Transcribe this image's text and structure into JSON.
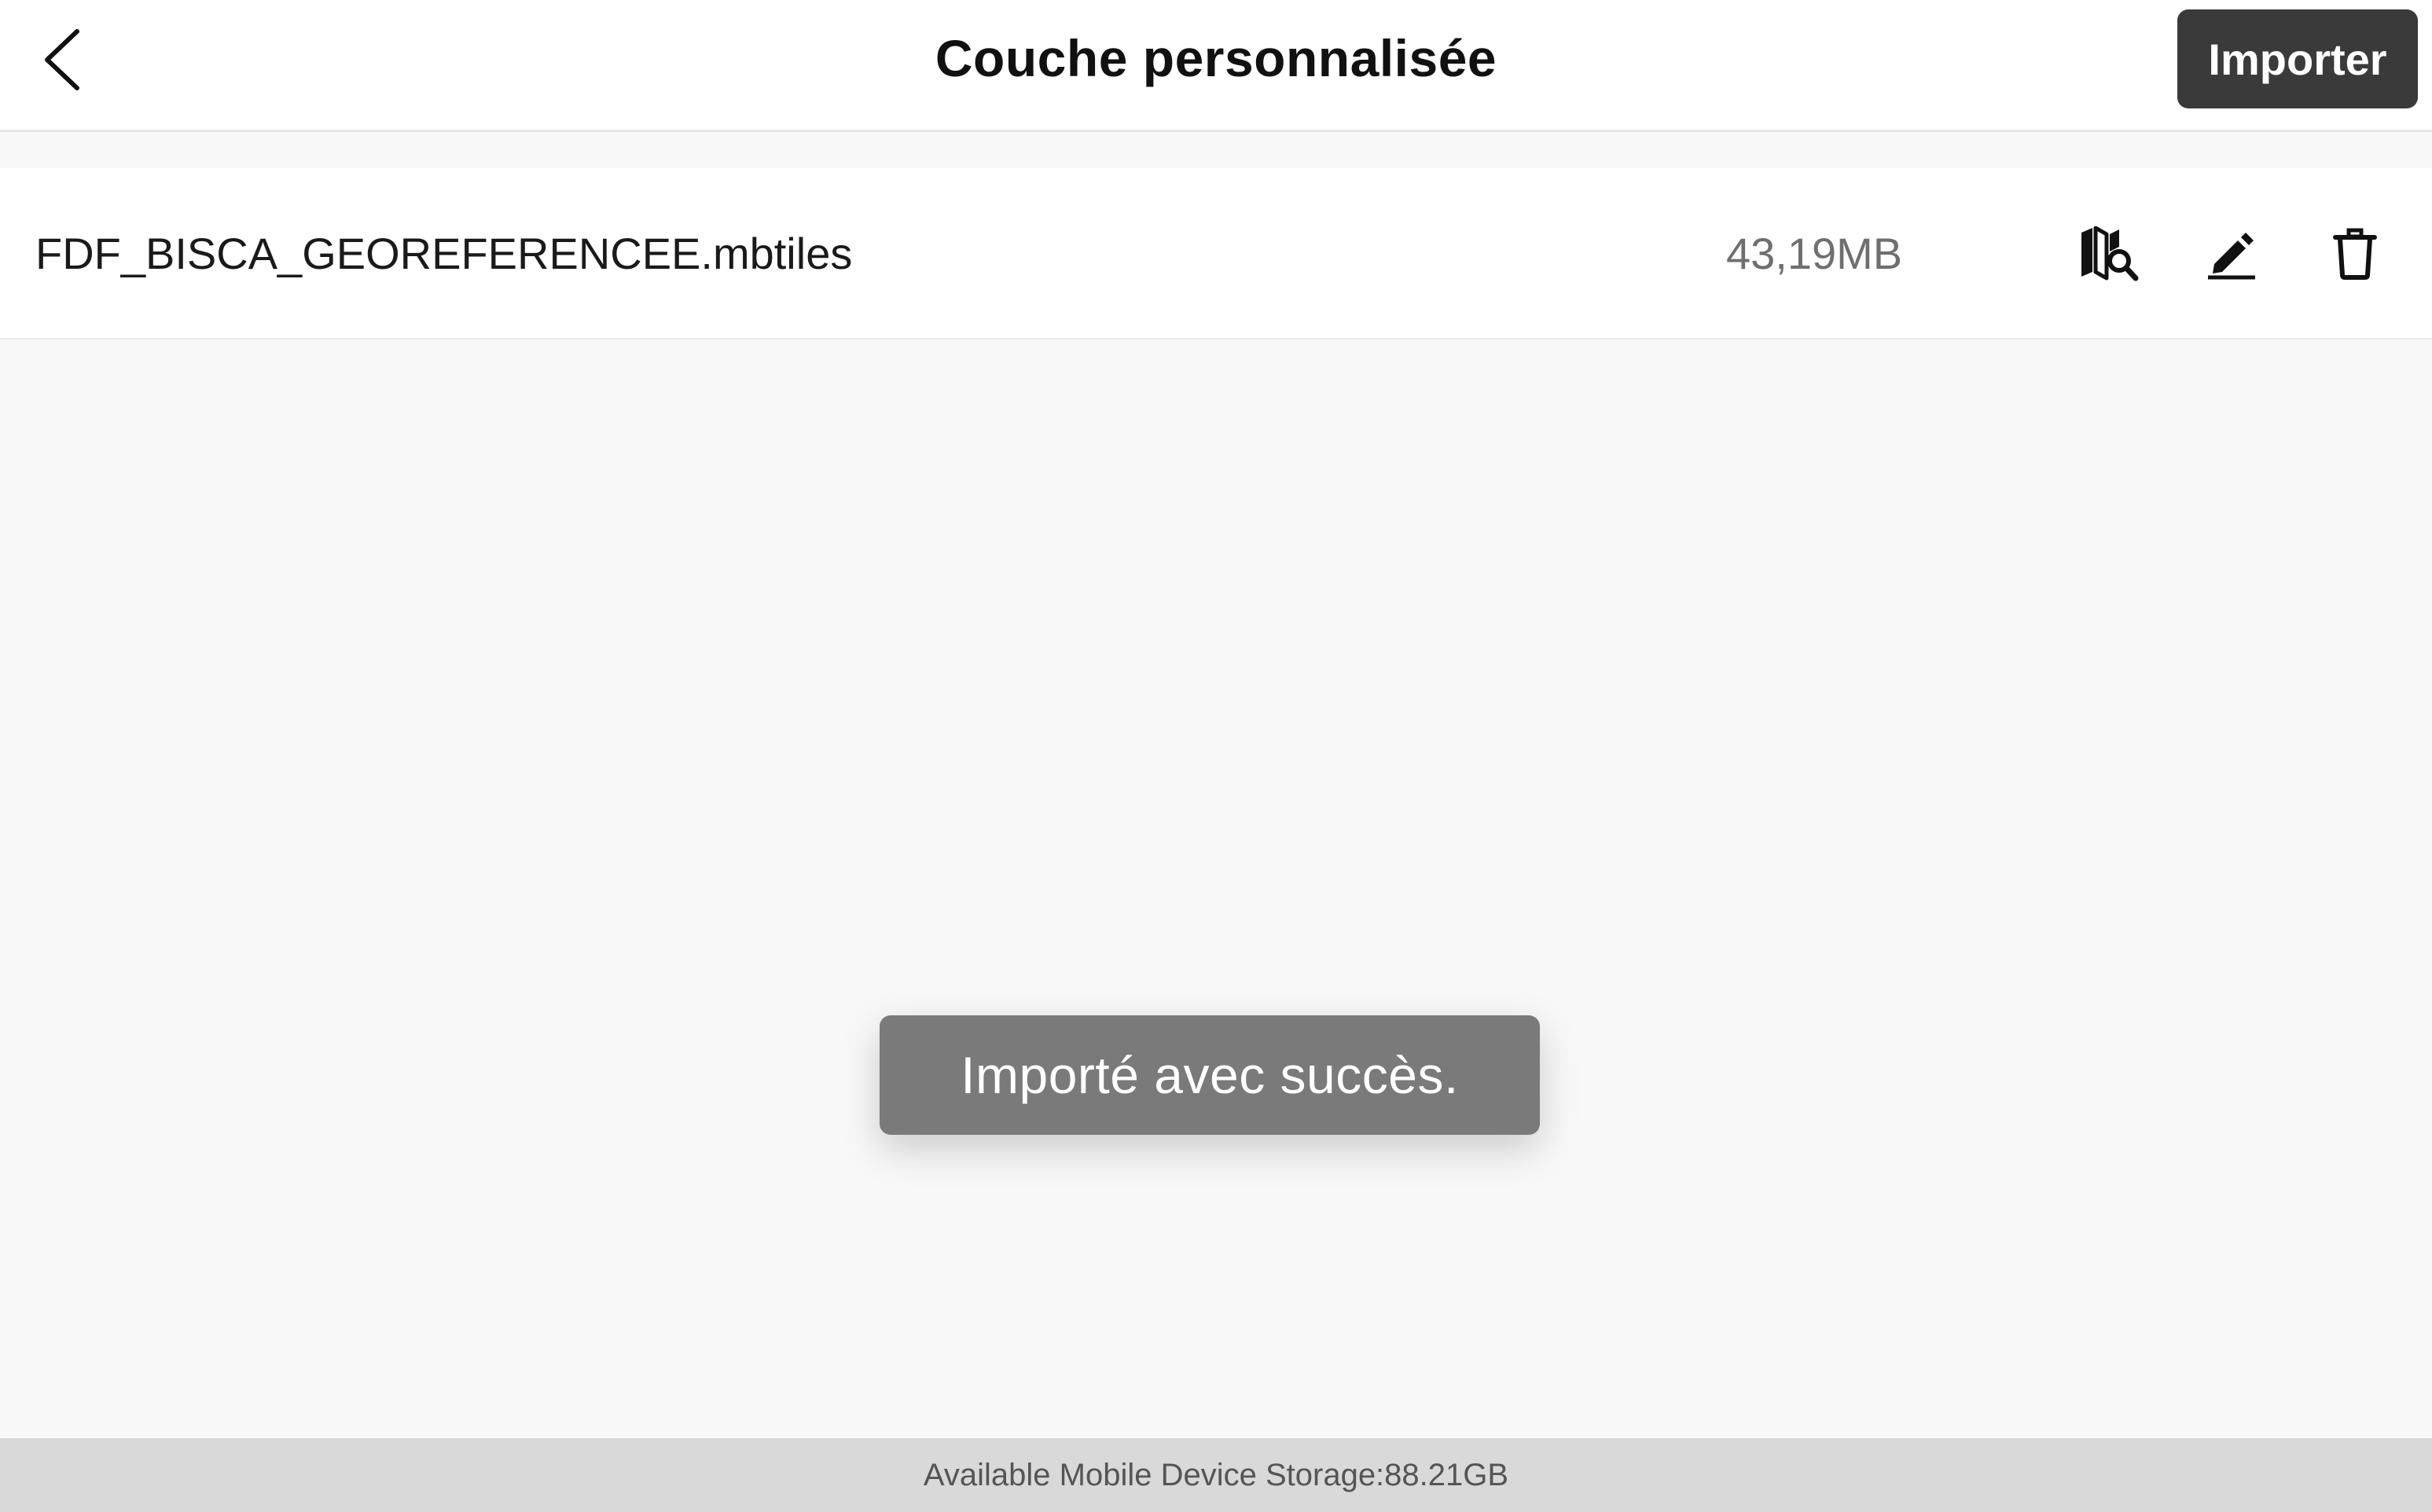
{
  "header": {
    "title": "Couche personnalisée",
    "back_icon": "chevron-left-icon",
    "import_label": "Importer"
  },
  "files": [
    {
      "name": "FDF_BISCA_GEOREFERENCEE.mbtiles",
      "size": "43,19MB",
      "actions": [
        "map-search-icon",
        "pencil-icon",
        "trash-icon"
      ]
    }
  ],
  "toast": {
    "message": "Importé avec succès."
  },
  "footer": {
    "storage_text": "Available Mobile Device Storage:88.21GB"
  },
  "colors": {
    "accent_button": "#3a3a3a",
    "toast_background": "#7a7a7a",
    "footer_background": "#d9d9d9",
    "page_background": "#f8f8f8"
  }
}
